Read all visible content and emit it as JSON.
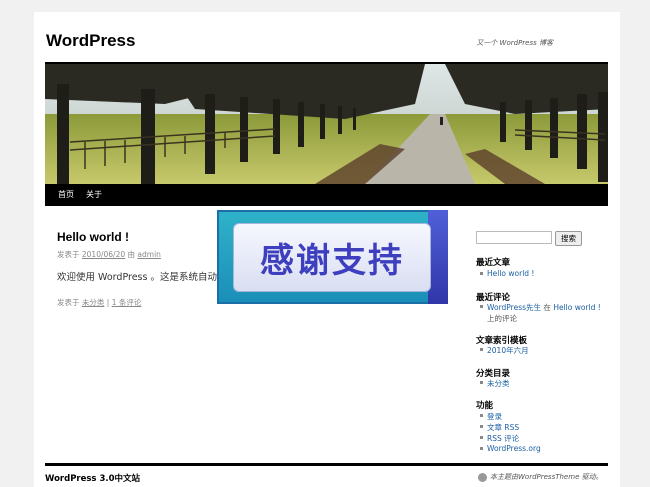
{
  "site": {
    "title": "WordPress",
    "description": "又一个 WordPress 博客"
  },
  "nav": {
    "home": "首页",
    "about": "关于"
  },
  "banner": {
    "text": "感谢支持"
  },
  "post": {
    "title": "Hello world !",
    "meta_prefix": "发表于",
    "date": "2010/06/20",
    "meta_by": "由",
    "author": "admin",
    "body": "欢迎使用 WordPress 。这是系统自动生成的演示文章。编辑或者删除它，然后开始您的博客！",
    "foot_prefix": "发表于",
    "category": "未分类",
    "separator": "|",
    "comments": "1 条评论"
  },
  "sidebar": {
    "search_button": "搜索",
    "recent_posts": {
      "title": "最近文章",
      "items": [
        "Hello world !"
      ]
    },
    "recent_comments": {
      "title": "最近评论",
      "author": "WordPress先生",
      "on": "在",
      "post": "Hello world !",
      "post_line2": "上的评论"
    },
    "archives": {
      "title": "文章索引模板",
      "items": [
        "2010年六月"
      ]
    },
    "categories": {
      "title": "分类目录",
      "items": [
        "未分类"
      ]
    },
    "meta": {
      "title": "功能",
      "items": [
        "登录",
        "文章 RSS",
        "RSS 评论",
        "WordPress.org"
      ]
    }
  },
  "footer": {
    "title": "WordPress 3.0中文站",
    "note": "本主题由WordPressTheme 驱动。"
  }
}
